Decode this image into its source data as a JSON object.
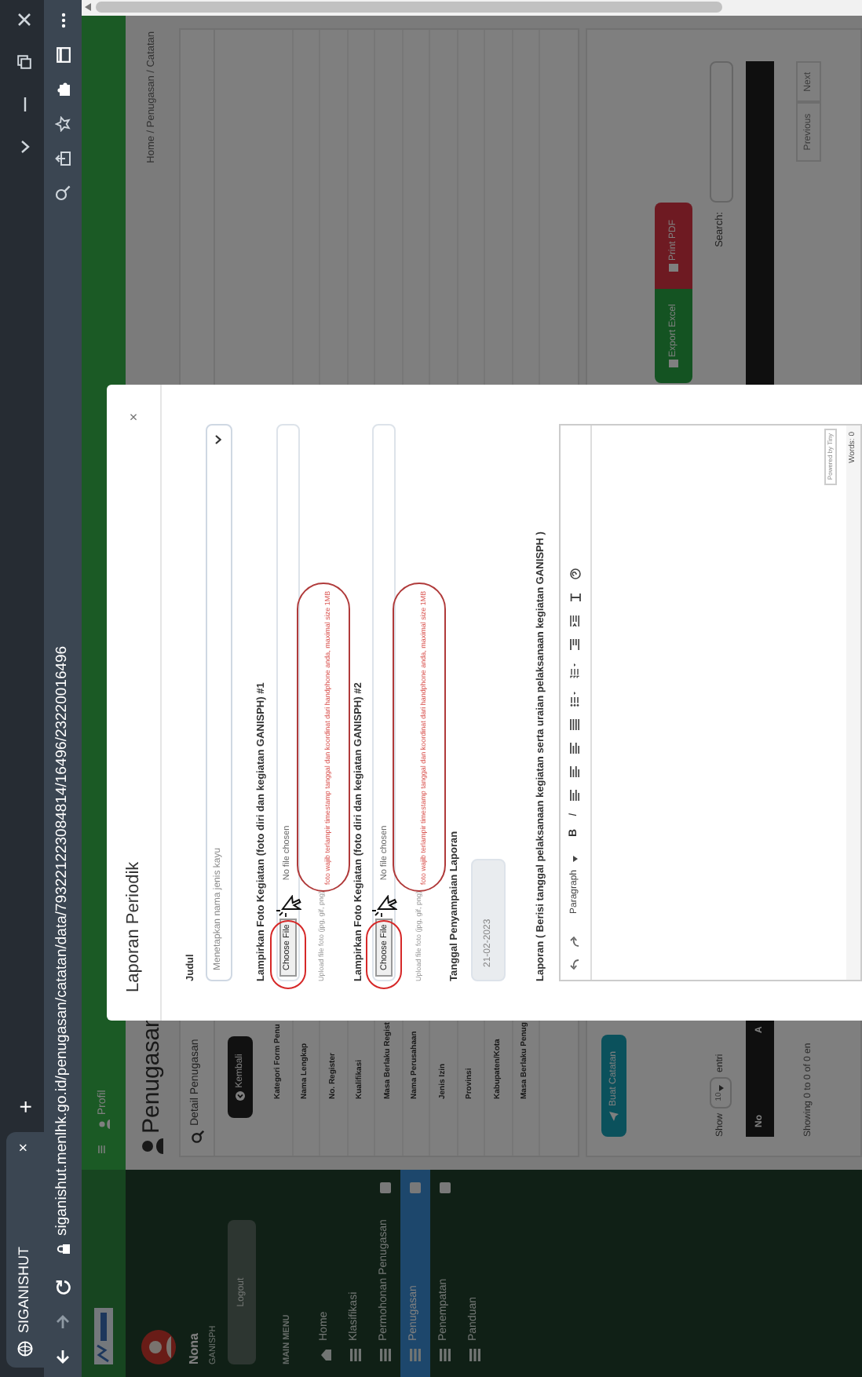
{
  "browser": {
    "tab_title": "SIGANISHUT",
    "tab_close": "×",
    "new_tab": "+",
    "url": "siganishut.menlhk.go.id/penugasan/catatan/data/793221223084814/16496/23220016496"
  },
  "sidebar": {
    "user_name": "Nona",
    "user_role": "GANISPH",
    "logout": "Logout",
    "section": "MAIN MENU",
    "items": [
      {
        "label": "Home",
        "selected": false,
        "badge": false
      },
      {
        "label": "Klasifikasi",
        "selected": false,
        "badge": false
      },
      {
        "label": "Permohonan Penugasan",
        "selected": false,
        "badge": true
      },
      {
        "label": "Penugasan",
        "selected": true,
        "badge": true
      },
      {
        "label": "Penempatan",
        "selected": false,
        "badge": true
      },
      {
        "label": "Panduan",
        "selected": false,
        "badge": false
      }
    ]
  },
  "header": {
    "menu_glyph": "≡",
    "profile": "Profil"
  },
  "page": {
    "title": "Penugasan",
    "breadcrumb": "Home / Penugasan / Catatan",
    "card_title": "Detail Penugasan",
    "back_button": "Kembali",
    "detail_rows": [
      "Kategori Form Penu",
      "Nama Lengkap",
      "No. Register",
      "Kualifikasi",
      "Masa Berlaku Regist",
      "Nama Perusahaan",
      "Jenis Izin",
      "Provinsi",
      "Kabupaten/Kota",
      "Masa Berlaku Penug"
    ],
    "create_button": "Buat Catatan",
    "export_button": "Export Excel",
    "print_button": "Print PDF",
    "show_label": "Show",
    "page_size": "10",
    "entries_label": "entri",
    "search_label": "Search:",
    "table_columns": [
      "No",
      "A"
    ],
    "info": "Showing 0 to 0 of 0 en",
    "pagination": [
      "Previous",
      "Next"
    ]
  },
  "modal": {
    "title": "Laporan Periodik",
    "close": "×",
    "fields": [
      {
        "kind": "select",
        "label": "Judul",
        "placeholder": "Menetapkan nama jenis kayu"
      },
      {
        "kind": "file",
        "label": "Lampirkan Foto Kegiatan (foto diri dan kegiatan GANISPH) #1",
        "button": "Choose File",
        "status": "No file chosen",
        "hint": "Upload file foto (jpg, gif, png)",
        "warning": "foto wajib terlampir timestamp tanggal dan koordinat dari handphone anda, maximal size 1MB",
        "annotated": true
      },
      {
        "kind": "file",
        "label": "Lampirkan Foto Kegiatan (foto diri dan kegiatan GANISPH) #2",
        "button": "Choose File",
        "status": "No file chosen",
        "hint": "Upload file foto (jpg, gif, png)",
        "warning": "foto wajib terlampir timestamp tanggal dan koordinat dari handphone anda, maximal size 1MB",
        "annotated": true
      },
      {
        "kind": "date",
        "label": "Tanggal Penyampaian Laporan",
        "value": "21-02-2023",
        "disabled": true
      },
      {
        "kind": "editor",
        "label": "Laporan ( Berisi tanggal pelaksanaan kegiatan serta uraian pelaksanaan kegiatan GANISPH )",
        "block_format": "Paragraph",
        "bold_glyph": "B",
        "italic_glyph": "I",
        "branding": "Powered by Tiny",
        "word_count": "Words: 0"
      }
    ]
  }
}
